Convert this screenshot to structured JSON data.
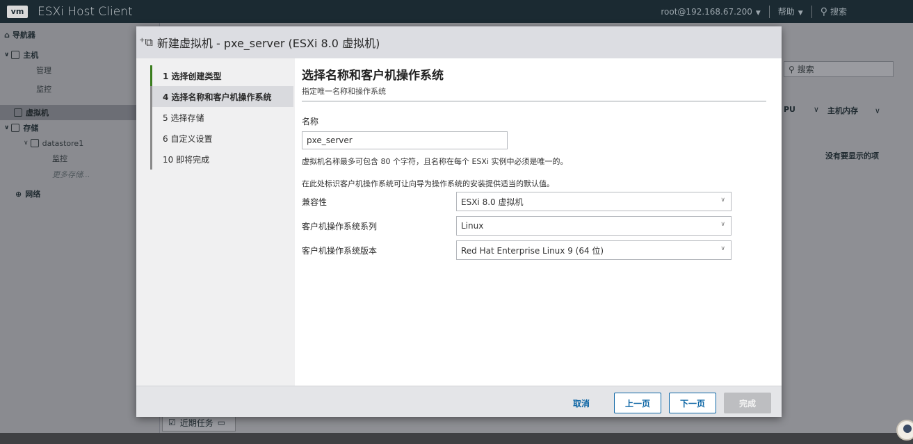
{
  "topbar": {
    "logo": "vm",
    "app_title": "ESXi Host Client",
    "user": "root@192.168.67.200",
    "help": "帮助",
    "search": "搜索"
  },
  "navigator": {
    "header": "导航器",
    "items": [
      {
        "label": "主机"
      },
      {
        "label": "管理"
      },
      {
        "label": "监控"
      },
      {
        "label": "虚拟机"
      },
      {
        "label": "存储"
      },
      {
        "label": "datastore1"
      },
      {
        "label": "监控"
      },
      {
        "label": "更多存储..."
      },
      {
        "label": "网络"
      }
    ]
  },
  "background_panel": {
    "search_placeholder": "搜索",
    "col_cpu": "PU",
    "col_mem": "主机内存",
    "empty_text": "没有要显示的项"
  },
  "recent_tasks": {
    "label": "近期任务"
  },
  "modal": {
    "title": "新建虚拟机 - pxe_server (ESXi 8.0 虚拟机)",
    "steps": [
      {
        "label": "1  选择创建类型"
      },
      {
        "label": "4  选择名称和客户机操作系统"
      },
      {
        "label": "5  选择存储"
      },
      {
        "label": "6  自定义设置"
      },
      {
        "label": "10  即将完成"
      }
    ],
    "content": {
      "title": "选择名称和客户机操作系统",
      "subtitle": "指定唯一名称和操作系统",
      "name_label": "名称",
      "name_value": "pxe_server",
      "name_hint": "虚拟机名称最多可包含 80 个字符，且名称在每个 ESXi 实例中必须是唯一的。",
      "os_hint": "在此处标识客户机操作系统可让向导为操作系统的安装提供适当的默认值。",
      "compat_label": "兼容性",
      "compat_value": "ESXi 8.0 虚拟机",
      "family_label": "客户机操作系统系列",
      "family_value": "Linux",
      "version_label": "客户机操作系统版本",
      "version_value": "Red Hat Enterprise Linux 9 (64 位)"
    },
    "buttons": {
      "cancel": "取消",
      "back": "上一页",
      "next": "下一页",
      "finish": "完成"
    }
  },
  "colors": {
    "accent": "#0a64a4",
    "step_done": "#3a7d1e",
    "topbar": "#1b2a32"
  }
}
